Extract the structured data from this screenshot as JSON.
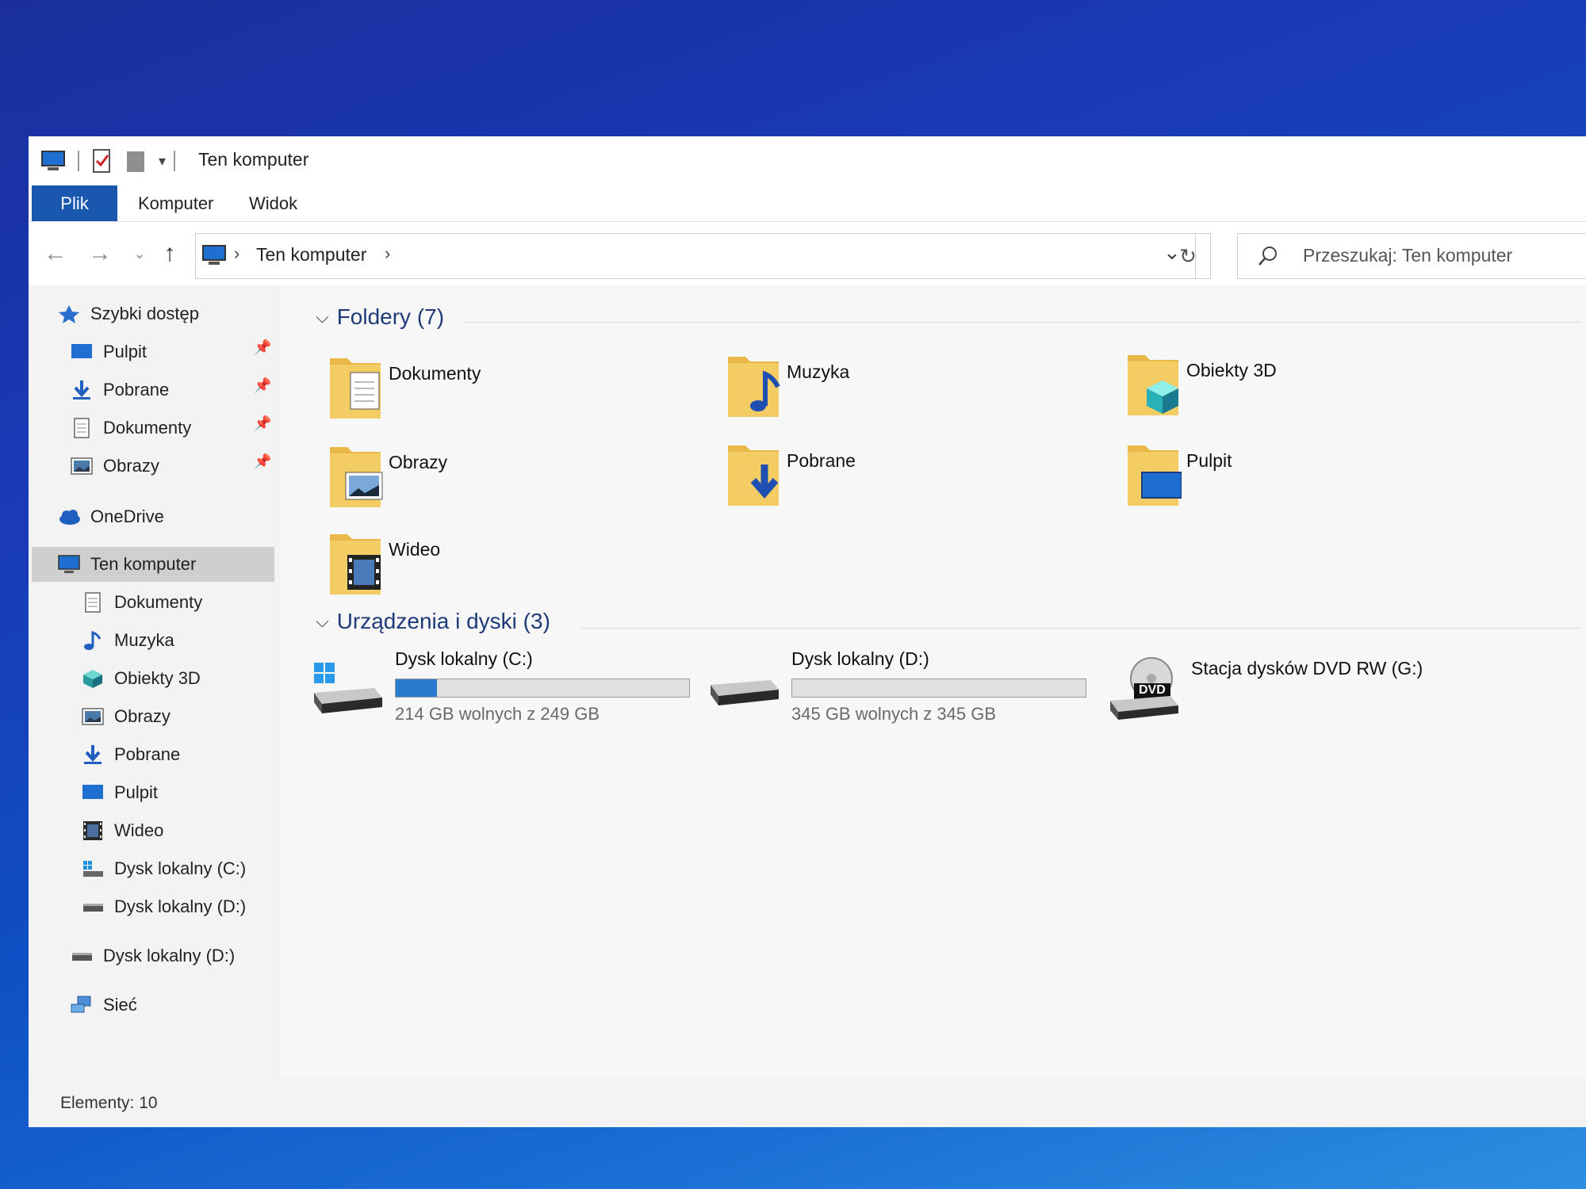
{
  "window": {
    "title": "Ten komputer"
  },
  "ribbon": {
    "tabs": [
      "Plik",
      "Komputer",
      "Widok"
    ]
  },
  "address": {
    "crumb": "Ten komputer",
    "search_placeholder": "Przeszukaj: Ten komputer"
  },
  "nav": {
    "quick_access": "Szybki dostęp",
    "quick_items": [
      "Pulpit",
      "Pobrane",
      "Dokumenty",
      "Obrazy"
    ],
    "onedrive": "OneDrive",
    "this_pc": "Ten komputer",
    "pc_items": [
      "Dokumenty",
      "Muzyka",
      "Obiekty 3D",
      "Obrazy",
      "Pobrane",
      "Pulpit",
      "Wideo",
      "Dysk lokalny (C:)",
      "Dysk lokalny (D:)"
    ],
    "extra_drive": "Dysk lokalny (D:)",
    "network": "Sieć"
  },
  "content": {
    "folders_header": "Foldery (7)",
    "folders": [
      "Dokumenty",
      "Muzyka",
      "Obiekty 3D",
      "Obrazy",
      "Pobrane",
      "Pulpit",
      "Wideo"
    ],
    "devices_header": "Urządzenia i dyski (3)",
    "drives": [
      {
        "name": "Dysk lokalny (C:)",
        "free": "214 GB wolnych z 249 GB",
        "used_fraction": 0.14
      },
      {
        "name": "Dysk lokalny (D:)",
        "free": "345 GB wolnych z 345 GB",
        "used_fraction": 0.0
      },
      {
        "name": "Stacja dysków DVD RW (G:)",
        "dvd_label": "DVD"
      }
    ]
  },
  "status": {
    "items": "Elementy: 10"
  },
  "colors": {
    "accent": "#1a58b0",
    "folder": "#e8b84a",
    "bar_fill": "#2a7bd0"
  }
}
